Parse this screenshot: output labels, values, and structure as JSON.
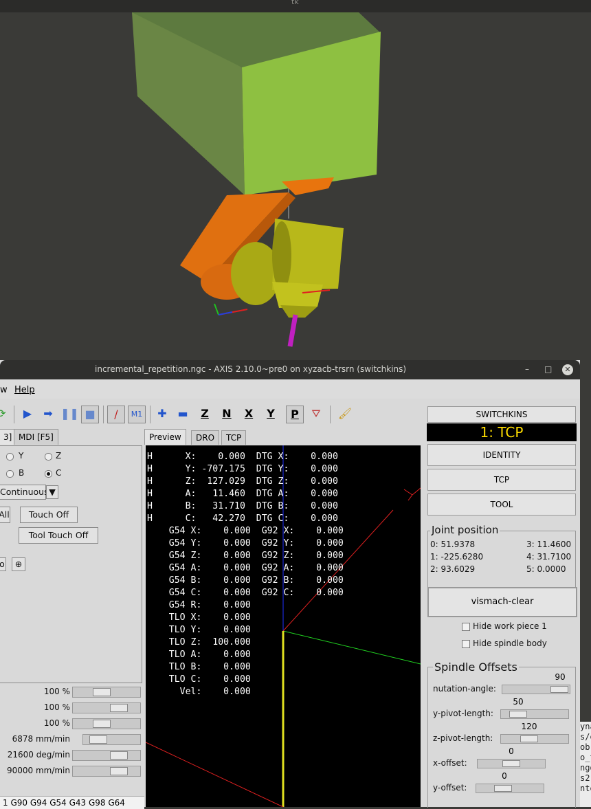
{
  "top_window": {
    "title": "tk"
  },
  "axis_window": {
    "title": "incremental_repetition.ngc - AXIS 2.10.0~pre0 on xyzacb-trsrn (switchkins)",
    "window_buttons": {
      "minimize": "–",
      "maximize": "□",
      "close": "✕"
    }
  },
  "menu": {
    "view_fragment": "w",
    "help": "Help"
  },
  "left_tabs": {
    "manual_fragment": "3]",
    "mdi": "MDI [F5]"
  },
  "axis_radios": {
    "y": "Y",
    "z": "Z",
    "b": "B",
    "c": "C",
    "selected": "C"
  },
  "jog": {
    "increment": "Continuous"
  },
  "buttons": {
    "home_all_fragment": "All",
    "touch_off": "Touch Off",
    "tool_touch_off": "Tool Touch Off",
    "spindle_fragment": "o"
  },
  "overrides": [
    {
      "value": "100 %",
      "level": 0.4
    },
    {
      "value": "100 %",
      "level": 0.75
    },
    {
      "value": "100 %",
      "level": 0.4
    },
    {
      "value": "6878 mm/min",
      "level": 0.15
    },
    {
      "value": "21600 deg/min",
      "level": 0.75
    },
    {
      "value": "90000 mm/min",
      "level": 0.75
    }
  ],
  "gcode_status": "1 G90 G94 G54 G43 G98 G64",
  "preview_tabs": {
    "preview": "Preview",
    "dro": "DRO",
    "tcp": "TCP"
  },
  "dro_lines": [
    "H      X:    0.000  DTG X:    0.000",
    "H      Y: -707.175  DTG Y:    0.000",
    "H      Z:  127.029  DTG Z:    0.000",
    "H      A:   11.460  DTG A:    0.000",
    "H      B:   31.710  DTG B:    0.000",
    "H      C:   42.270  DTG C:    0.000",
    "    G54 X:    0.000  G92 X:    0.000",
    "    G54 Y:    0.000  G92 Y:    0.000",
    "    G54 Z:    0.000  G92 Z:    0.000",
    "    G54 A:    0.000  G92 A:    0.000",
    "    G54 B:    0.000  G92 B:    0.000",
    "    G54 C:    0.000  G92 C:    0.000",
    "    G54 R:    0.000",
    "    TLO X:    0.000",
    "    TLO Y:    0.000",
    "    TLO Z:  100.000",
    "    TLO A:    0.000",
    "    TLO B:    0.000",
    "    TLO C:    0.000",
    "      Vel:    0.000"
  ],
  "switchkins": {
    "header": "SWITCHKINS",
    "display": "1:  TCP",
    "identity": "IDENTITY",
    "tcp": "TCP",
    "tool": "TOOL"
  },
  "joint_position": {
    "title": "Joint position",
    "joints": [
      "0: 51.9378",
      "3: 11.4600",
      "1: -225.6280",
      "4: 31.7100",
      "2: 93.6029",
      "5: 0.0000"
    ]
  },
  "vismach": {
    "clear": "vismach-clear",
    "hide_work_piece": "Hide work piece 1",
    "hide_spindle_body": "Hide spindle body"
  },
  "spindle_offsets": {
    "title": "Spindle Offsets",
    "params": [
      {
        "label": "nutation-angle:",
        "value": "90"
      },
      {
        "label": "y-pivot-length:",
        "value": "50"
      },
      {
        "label": "z-pivot-length:",
        "value": "120"
      },
      {
        "label": "x-offset:",
        "value": "0"
      },
      {
        "label": "y-offset:",
        "value": "0"
      }
    ]
  },
  "terminal_fragments": [
    "yna",
    "s/e",
    " ob",
    "o_t",
    "ngd",
    "s2.",
    "nte"
  ],
  "colors": {
    "viewport_bg": "#3a3a37",
    "housing_green": "#8ec041",
    "arm_orange": "#e8740e",
    "spindle_yellow": "#b8b81a",
    "kins_display_text": "#ffdd00"
  }
}
